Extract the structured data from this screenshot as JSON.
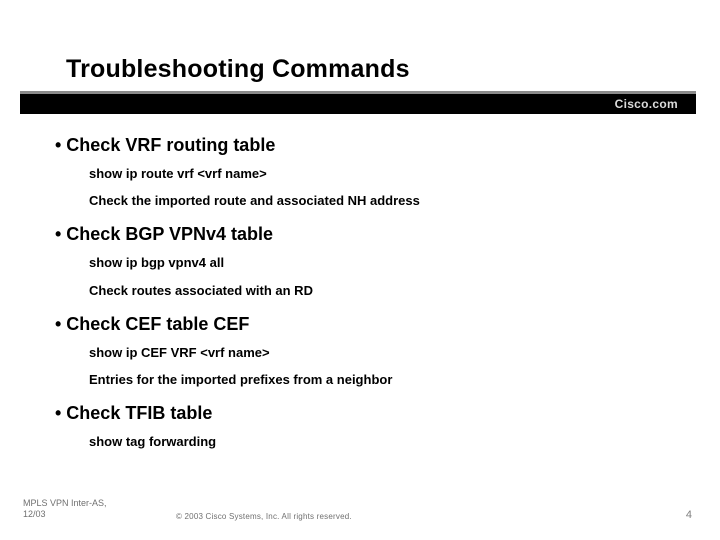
{
  "title": "Troubleshooting Commands",
  "brand": "Cisco.com",
  "sections": [
    {
      "bullet": "• Check VRF routing table",
      "sub1": "show ip route vrf <vrf name>",
      "sub2": "Check the imported route and associated NH address"
    },
    {
      "bullet": "•  Check BGP VPNv4 table",
      "sub1": "show ip bgp vpnv4 all",
      "sub2": "Check routes associated with an RD"
    },
    {
      "bullet": "• Check CEF table CEF",
      "sub1": "show ip CEF VRF <vrf name>",
      "sub2": "Entries for the imported prefixes from a neighbor"
    },
    {
      "bullet": "• Check TFIB table",
      "sub1": "show tag forwarding",
      "sub2": ""
    }
  ],
  "footer": {
    "left_line1": "MPLS VPN Inter-AS,",
    "left_line2": "12/03",
    "copyright": "© 2003 Cisco Systems, Inc. All rights reserved.",
    "page": "4"
  }
}
